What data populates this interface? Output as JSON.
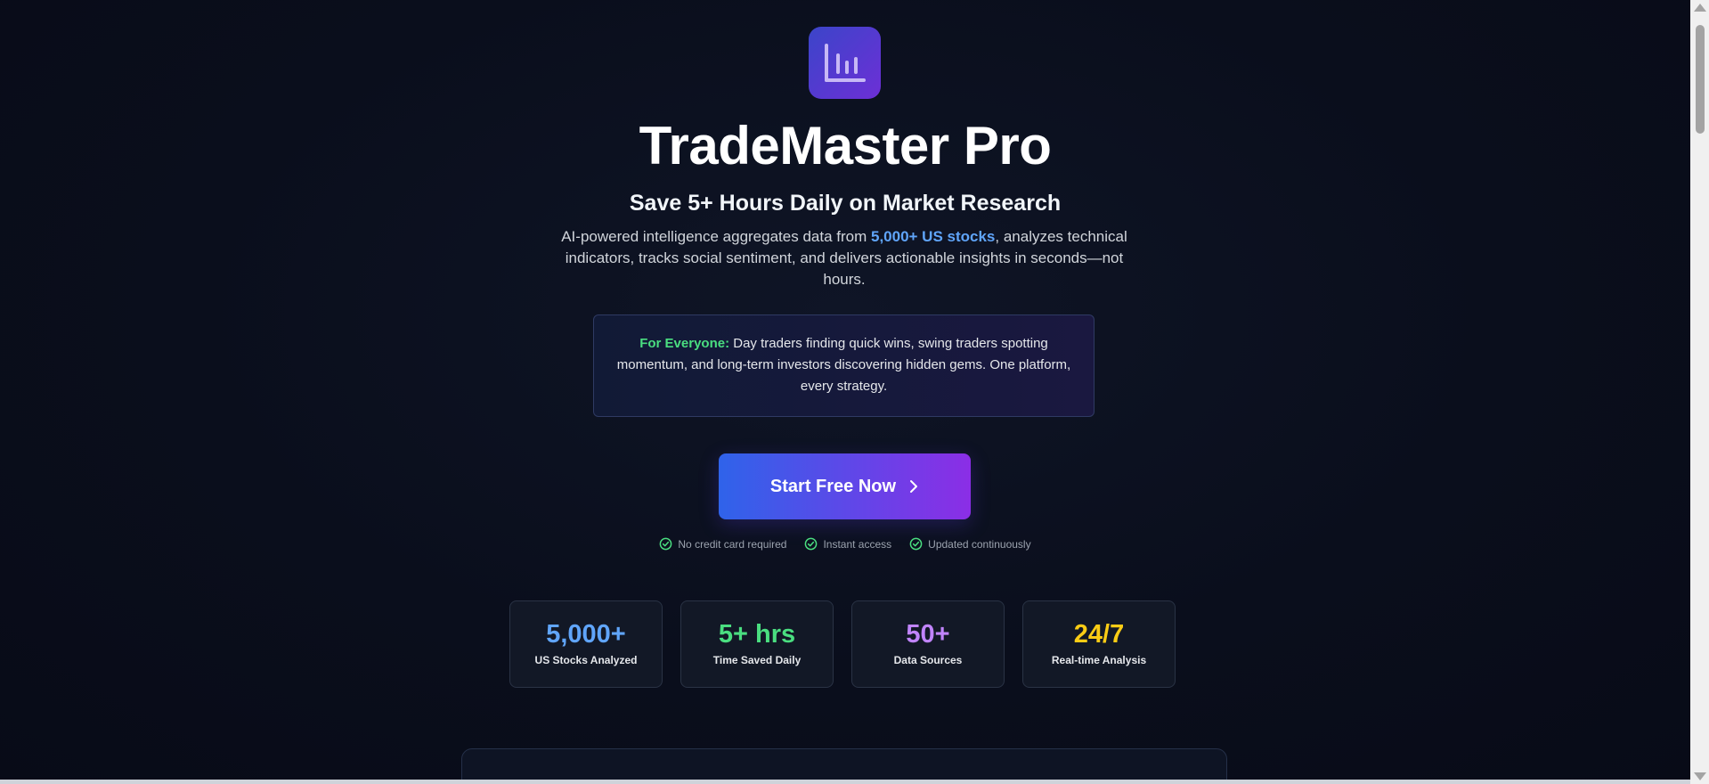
{
  "brand": {
    "logo_icon": "bar-chart-icon",
    "title": "TradeMaster Pro",
    "accent_from": "#3b45c9",
    "accent_to": "#6d2fd6"
  },
  "hero": {
    "subtitle": "Save 5+ Hours Daily on Market Research",
    "desc_before": "AI-powered intelligence aggregates data from ",
    "desc_highlight": "5,000+ US stocks",
    "desc_after": ", analyzes technical indicators, tracks social sentiment, and delivers actionable insights in seconds—not hours."
  },
  "callout": {
    "lead": "For Everyone:",
    "text": " Day traders finding quick wins, swing traders spotting momentum, and long-term investors discovering hidden gems. One platform, every strategy."
  },
  "cta": {
    "label": "Start Free Now",
    "icon": "chevron-right-icon"
  },
  "checks": [
    {
      "icon": "check-circle-icon",
      "label": "No credit card required"
    },
    {
      "icon": "check-circle-icon",
      "label": "Instant access"
    },
    {
      "icon": "check-circle-icon",
      "label": "Updated continuously"
    }
  ],
  "stats": [
    {
      "value": "5,000+",
      "label": "US Stocks Analyzed",
      "color": "#60a5fa"
    },
    {
      "value": "5+ hrs",
      "label": "Time Saved Daily",
      "color": "#4ade80"
    },
    {
      "value": "50+",
      "label": "Data Sources",
      "color": "#c084fc"
    },
    {
      "value": "24/7",
      "label": "Real-time Analysis",
      "color": "#facc15"
    }
  ]
}
